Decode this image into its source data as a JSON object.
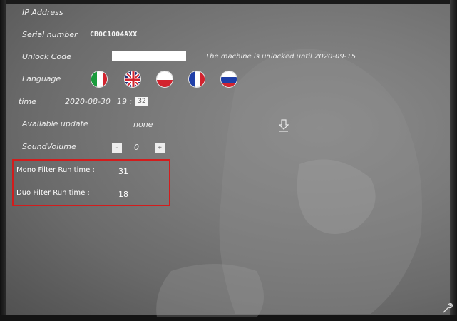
{
  "settings": {
    "ip_address_label": "IP Address",
    "serial_label": "Serial number",
    "serial_value": "CB0C1004AXX",
    "unlock_label": "Unlock Code",
    "unlock_value": "",
    "unlock_status": "The machine is unlocked until 2020-09-15",
    "language_label": "Language",
    "languages": [
      {
        "name": "italian-flag",
        "colors": [
          "#1a9b3c",
          "#ffffff",
          "#d3232e"
        ]
      },
      {
        "name": "uk-flag",
        "colors": [
          "#1f2f7a",
          "#ffffff",
          "#d3232e"
        ]
      },
      {
        "name": "polish-flag",
        "colors": [
          "#ffffff",
          "#d3232e"
        ]
      },
      {
        "name": "french-flag",
        "colors": [
          "#1f3fa8",
          "#ffffff",
          "#d3232e"
        ]
      },
      {
        "name": "russian-flag",
        "colors": [
          "#ffffff",
          "#1f3fa8",
          "#d3232e"
        ]
      }
    ],
    "time_label": "time",
    "date_value": "2020-08-30",
    "hour_value": "19 :",
    "minute_value": "32",
    "update_label": "Available update",
    "update_value": "none",
    "volume_label": "SoundVolume",
    "volume_minus": "-",
    "volume_value": "0",
    "volume_plus": "+"
  },
  "filters": {
    "mono_label": "Mono Filter Run time :",
    "mono_value": "31",
    "duo_label": "Duo Filter Run time :",
    "duo_value": "18"
  },
  "icons": {
    "download": "download-icon",
    "wrench": "wrench-icon"
  },
  "colors": {
    "highlight": "#d31c1c",
    "text": "#ededed"
  }
}
